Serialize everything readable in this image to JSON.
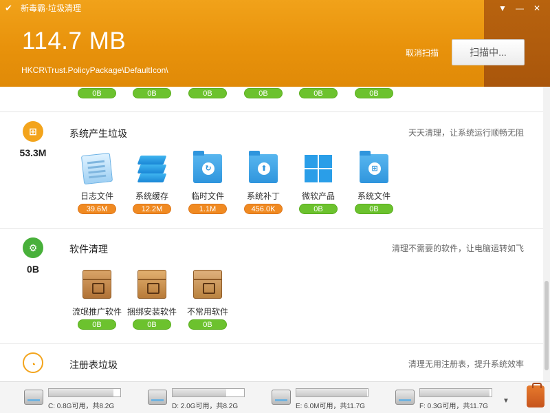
{
  "app": {
    "title": "新毒霸·垃圾清理"
  },
  "header": {
    "total_size": "114.7 MB",
    "scan_path": "HKCR\\Trust.PolicyPackage\\DefaultIcon\\",
    "cancel_label": "取消扫描",
    "scan_button_label": "扫描中..."
  },
  "top_partial": {
    "pills": [
      "0B",
      "0B",
      "0B",
      "0B",
      "0B",
      "0B"
    ]
  },
  "system_section": {
    "size": "53.3M",
    "title": "系统产生垃圾",
    "desc": "天天清理，让系统运行顺畅无阻",
    "items": [
      {
        "label": "日志文件",
        "value": "39.6M",
        "status": "orange",
        "icon": "log-file-icon"
      },
      {
        "label": "系统缓存",
        "value": "12.2M",
        "status": "orange",
        "icon": "cache-stack-icon"
      },
      {
        "label": "临时文件",
        "value": "1.1M",
        "status": "orange",
        "icon": "temp-folder-icon"
      },
      {
        "label": "系统补丁",
        "value": "456.0K",
        "status": "orange",
        "icon": "patch-folder-icon"
      },
      {
        "label": "微软产品",
        "value": "0B",
        "status": "green",
        "icon": "windows-logo-icon"
      },
      {
        "label": "系统文件",
        "value": "0B",
        "status": "green",
        "icon": "system-folder-icon"
      }
    ]
  },
  "software_section": {
    "size": "0B",
    "title": "软件清理",
    "desc": "清理不需要的软件，让电脑运转如飞",
    "items": [
      {
        "label": "流氓推广软件",
        "value": "0B",
        "status": "green",
        "icon": "box-icon"
      },
      {
        "label": "捆绑安装软件",
        "value": "0B",
        "status": "green",
        "icon": "bundle-box-icon"
      },
      {
        "label": "不常用软件",
        "value": "0B",
        "status": "green",
        "icon": "box-icon"
      }
    ]
  },
  "registry_section": {
    "title": "注册表垃圾",
    "desc": "清理无用注册表，提升系统效率"
  },
  "drives": [
    {
      "label": "C: 0.8G可用，共8.2G",
      "used_fraction": 0.9
    },
    {
      "label": "D: 2.0G可用，共8.2G",
      "used_fraction": 0.75
    },
    {
      "label": "E: 6.0M可用，共11.7G",
      "used_fraction": 0.99
    },
    {
      "label": "F: 0.3G可用，共11.7G",
      "used_fraction": 0.97
    }
  ],
  "colors": {
    "header_orange": "#e8920b",
    "pill_green": "#6cc22e",
    "pill_orange": "#f08a22"
  }
}
